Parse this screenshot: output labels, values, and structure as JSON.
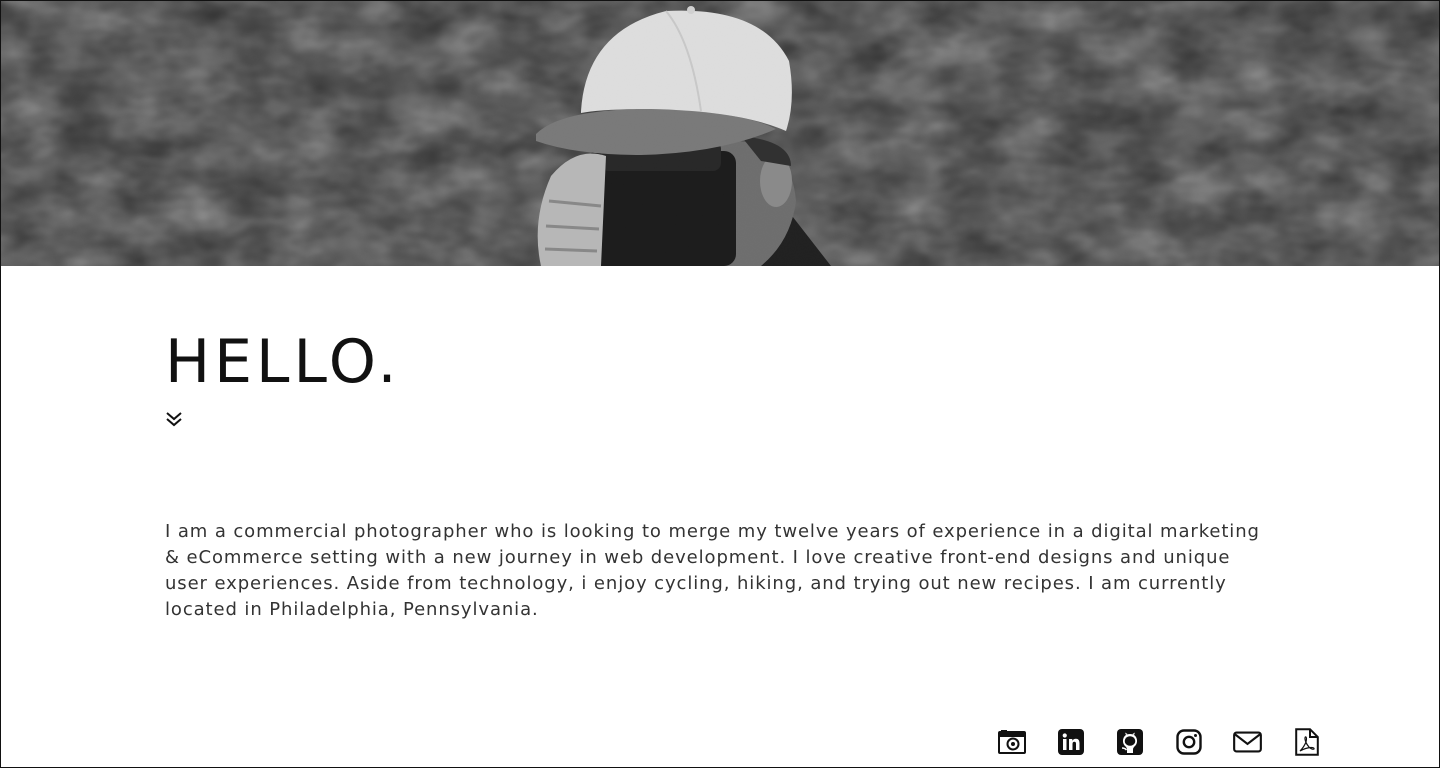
{
  "hero": {
    "alt": "Black and white photo of a person in a cap holding a camera"
  },
  "main": {
    "title": "HELLO.",
    "bio": "I am a commercial photographer who is looking to merge my twelve years of experience in a digital marketing & eCommerce setting with a new journey in web development. I love creative front-end designs and unique user experiences. Aside from technology, i enjoy cycling, hiking, and trying out new recipes. I am currently located in Philadelphia, Pennsylvania."
  },
  "social": [
    {
      "icon": "camera-icon"
    },
    {
      "icon": "linkedin-icon"
    },
    {
      "icon": "github-icon"
    },
    {
      "icon": "instagram-icon"
    },
    {
      "icon": "email-icon"
    },
    {
      "icon": "pdf-icon"
    }
  ],
  "colors": {
    "text": "#111111",
    "body_text": "#333333",
    "background": "#ffffff"
  }
}
